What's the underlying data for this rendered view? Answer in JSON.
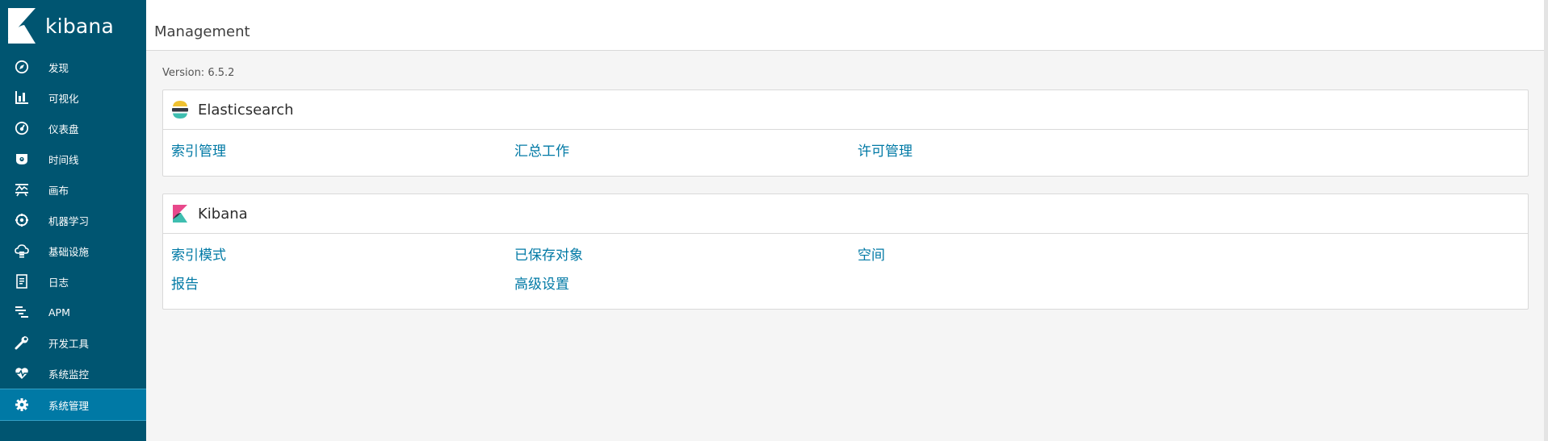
{
  "brand": {
    "name": "kibana"
  },
  "colors": {
    "sidebar": "#005571",
    "active": "#0079a5",
    "link": "#0079a5"
  },
  "nav": [
    {
      "label": "发现",
      "icon": "compass-icon"
    },
    {
      "label": "可视化",
      "icon": "bar-chart-icon"
    },
    {
      "label": "仪表盘",
      "icon": "dashboard-icon"
    },
    {
      "label": "时间线",
      "icon": "timeline-icon"
    },
    {
      "label": "画布",
      "icon": "canvas-icon"
    },
    {
      "label": "机器学习",
      "icon": "machine-learning-icon"
    },
    {
      "label": "基础设施",
      "icon": "infrastructure-icon"
    },
    {
      "label": "日志",
      "icon": "logs-icon"
    },
    {
      "label": "APM",
      "icon": "apm-icon"
    },
    {
      "label": "开发工具",
      "icon": "wrench-icon"
    },
    {
      "label": "系统监控",
      "icon": "heart-monitor-icon"
    },
    {
      "label": "系统管理",
      "icon": "gear-icon",
      "active": true
    }
  ],
  "header": {
    "title": "Management"
  },
  "version_text": "Version: 6.5.2",
  "sections": [
    {
      "title": "Elasticsearch",
      "icon": "elasticsearch-logo-icon",
      "links": [
        "索引管理",
        "汇总工作",
        "许可管理"
      ]
    },
    {
      "title": "Kibana",
      "icon": "kibana-logo-icon",
      "links": [
        "索引模式",
        "已保存对象",
        "空间",
        "报告",
        "高级设置"
      ]
    }
  ]
}
